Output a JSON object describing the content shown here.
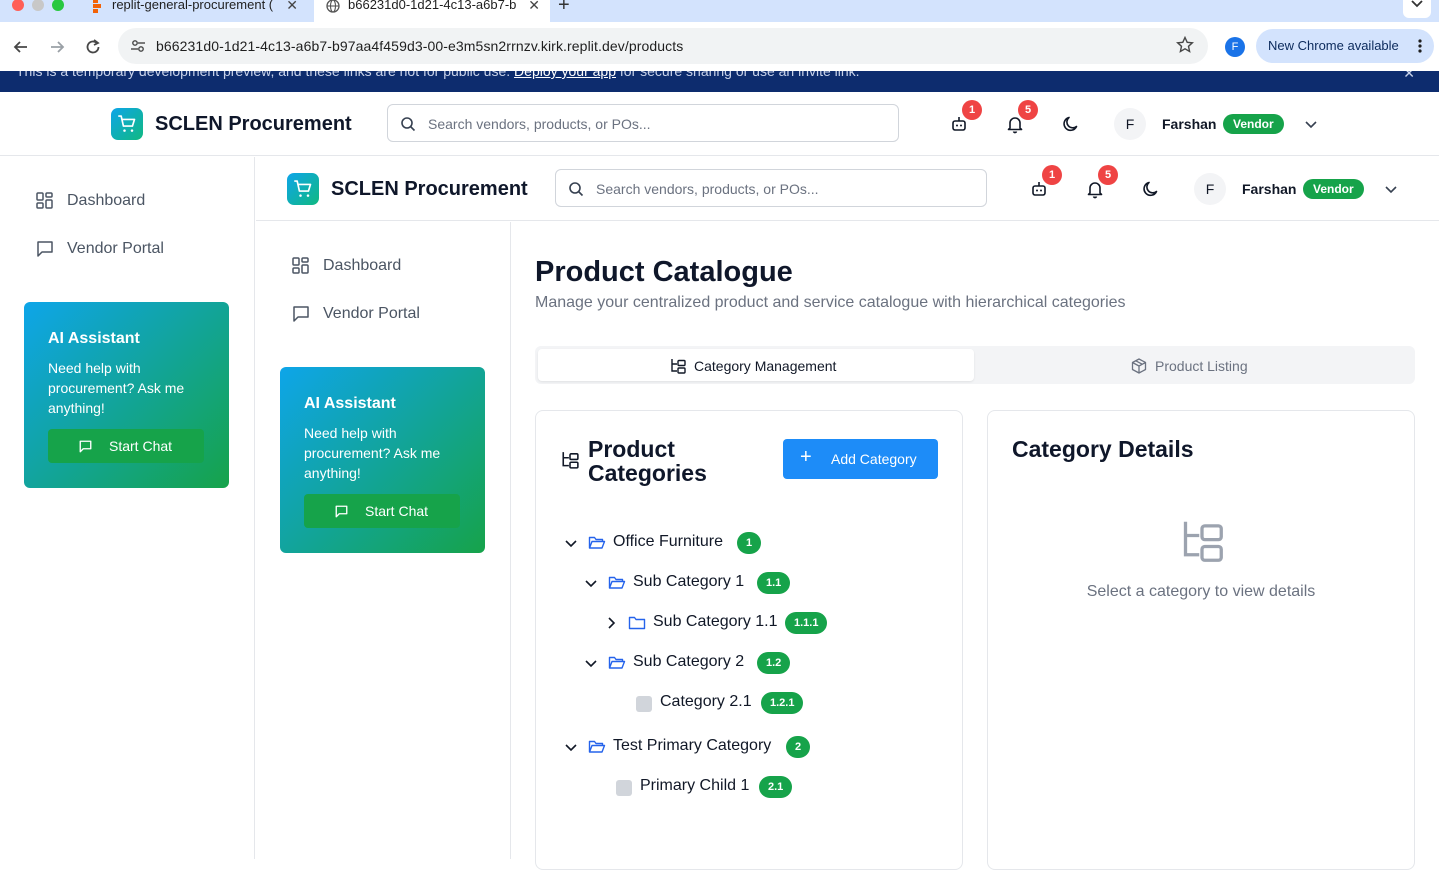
{
  "browser": {
    "tabs": [
      {
        "title": "replit-general-procurement (",
        "active": false
      },
      {
        "title": "b66231d0-1d21-4c13-a6b7-b",
        "active": true
      }
    ],
    "url": "b66231d0-1d21-4c13-a6b7-b97aa4f459d3-00-e3m5sn2rrnzv.kirk.replit.dev/products",
    "profile_initial": "F",
    "update_label": "New Chrome available"
  },
  "banner": {
    "text_before": "This is a temporary development preview, and these links are not for public use. ",
    "link": "Deploy your app",
    "text_after": " for secure sharing or use an invite link."
  },
  "header": {
    "brand": "SCLEN Procurement",
    "search_placeholder": "Search vendors, products, or POs...",
    "ai_badge": "1",
    "notif_badge": "5",
    "avatar_initial": "F",
    "user_name": "Farshan",
    "role": "Vendor"
  },
  "sidebar": {
    "items": [
      {
        "label": "Dashboard",
        "icon": "dashboard-grid-icon"
      },
      {
        "label": "Vendor Portal",
        "icon": "message-square-icon"
      }
    ],
    "ai": {
      "title": "AI Assistant",
      "description": "Need help with procurement? Ask me anything!",
      "button": "Start Chat"
    }
  },
  "main": {
    "title": "Product Catalogue",
    "subtitle": "Manage your centralized product and service catalogue with hierarchical categories",
    "tabs": [
      {
        "label": "Category Management",
        "active": true
      },
      {
        "label": "Product Listing",
        "active": false
      }
    ],
    "categories": {
      "title_line1": "Product",
      "title_line2": "Categories",
      "add_button": "Add Category",
      "tree": [
        {
          "label": "Office Furniture",
          "code": "1",
          "level": 0,
          "state": "expanded"
        },
        {
          "label": "Sub Category 1",
          "code": "1.1",
          "level": 1,
          "state": "expanded"
        },
        {
          "label": "Sub Category 1.1",
          "code": "1.1.1",
          "level": 2,
          "state": "collapsed"
        },
        {
          "label": "Sub Category 2",
          "code": "1.2",
          "level": 1,
          "state": "expanded"
        },
        {
          "label": "Category 2.1",
          "code": "1.2.1",
          "level": 2,
          "state": "leaf"
        },
        {
          "label": "Test Primary Category",
          "code": "2",
          "level": 0,
          "state": "expanded"
        },
        {
          "label": "Primary Child 1",
          "code": "2.1",
          "level": 1,
          "state": "leaf"
        }
      ]
    },
    "details": {
      "title": "Category Details",
      "empty_text": "Select a category to view details"
    }
  },
  "colors": {
    "brand_gradient_start": "#0ea5e9",
    "brand_gradient_end": "#16a34a",
    "badge_green": "#16a34a",
    "primary_blue": "#1d8cf8",
    "notification_red": "#ef4444",
    "banner_navy": "#0d2c6e"
  }
}
